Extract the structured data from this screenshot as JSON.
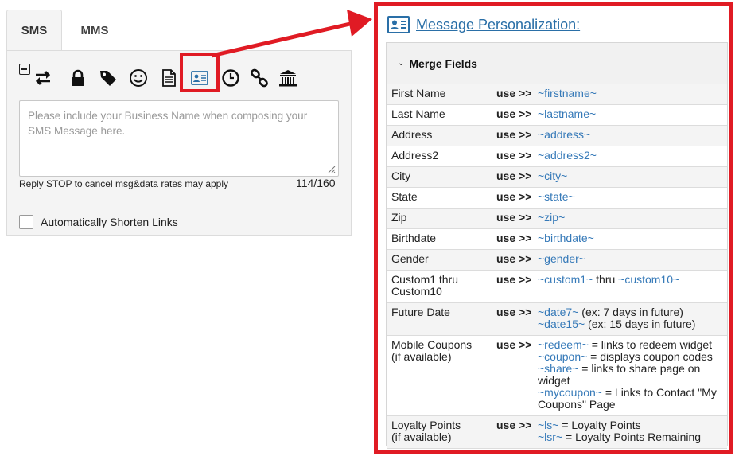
{
  "composer": {
    "tabs": [
      {
        "label": "SMS",
        "active": true
      },
      {
        "label": "MMS",
        "active": false
      }
    ],
    "toolbar_icons": [
      "collapse-icon",
      "swap-arrows-icon",
      "lock-icon",
      "tag-icon",
      "smiley-icon",
      "document-icon",
      "contact-card-icon",
      "clock-icon",
      "link-icon",
      "bank-icon"
    ],
    "message_placeholder": "Please include your Business Name when composing your SMS Message here.",
    "footer_note": "Reply STOP to cancel msg&data rates may apply",
    "counter": "114/160",
    "shorten_links_label": "Automatically Shorten Links",
    "shorten_links_checked": false
  },
  "personalization": {
    "title": "Message Personalization:",
    "section_label": "Merge Fields",
    "use_label": "use >>",
    "fields": [
      {
        "name": "First Name",
        "lines": [
          [
            {
              "t": "~firstname~",
              "k": 1
            }
          ]
        ]
      },
      {
        "name": "Last Name",
        "lines": [
          [
            {
              "t": "~lastname~",
              "k": 1
            }
          ]
        ]
      },
      {
        "name": "Address",
        "lines": [
          [
            {
              "t": "~address~",
              "k": 1
            }
          ]
        ]
      },
      {
        "name": "Address2",
        "lines": [
          [
            {
              "t": "~address2~",
              "k": 1
            }
          ]
        ]
      },
      {
        "name": "City",
        "lines": [
          [
            {
              "t": "~city~",
              "k": 1
            }
          ]
        ]
      },
      {
        "name": "State",
        "lines": [
          [
            {
              "t": "~state~",
              "k": 1
            }
          ]
        ]
      },
      {
        "name": "Zip",
        "lines": [
          [
            {
              "t": "~zip~",
              "k": 1
            }
          ]
        ]
      },
      {
        "name": "Birthdate",
        "lines": [
          [
            {
              "t": "~birthdate~",
              "k": 1
            }
          ]
        ]
      },
      {
        "name": "Gender",
        "lines": [
          [
            {
              "t": "~gender~",
              "k": 1
            }
          ]
        ]
      },
      {
        "name": "Custom1 thru\nCustom10",
        "lines": [
          [
            {
              "t": "~custom1~",
              "k": 1
            },
            {
              "t": " thru ",
              "k": 0
            },
            {
              "t": "~custom10~",
              "k": 1
            }
          ]
        ]
      },
      {
        "name": "Future Date",
        "lines": [
          [
            {
              "t": "~date7~",
              "k": 1
            },
            {
              "t": " (ex: 7 days in future)",
              "k": 0
            }
          ],
          [
            {
              "t": "~date15~",
              "k": 1
            },
            {
              "t": " (ex: 15 days in future)",
              "k": 0
            }
          ]
        ]
      },
      {
        "name": "Mobile Coupons\n(if available)",
        "lines": [
          [
            {
              "t": "~redeem~",
              "k": 1
            },
            {
              "t": " = links to redeem widget",
              "k": 0
            }
          ],
          [
            {
              "t": "~coupon~",
              "k": 1
            },
            {
              "t": " = displays coupon codes",
              "k": 0
            }
          ],
          [
            {
              "t": "~share~",
              "k": 1
            },
            {
              "t": " = links to share page on",
              "k": 0
            }
          ],
          [
            {
              "t": "widget",
              "k": 0
            }
          ],
          [
            {
              "t": "~mycoupon~",
              "k": 1
            },
            {
              "t": " = Links to Contact \"My",
              "k": 0
            }
          ],
          [
            {
              "t": "Coupons\" Page",
              "k": 0
            }
          ]
        ]
      },
      {
        "name": "Loyalty Points\n(if available)",
        "lines": [
          [
            {
              "t": "~ls~",
              "k": 1
            },
            {
              "t": " = Loyalty Points",
              "k": 0
            }
          ],
          [
            {
              "t": "~lsr~",
              "k": 1
            },
            {
              "t": " = Loyalty Points Remaining",
              "k": 0
            }
          ]
        ]
      }
    ]
  },
  "colors": {
    "highlight": "#e01b24",
    "link": "#2a6fa7",
    "token": "#3579b8"
  }
}
